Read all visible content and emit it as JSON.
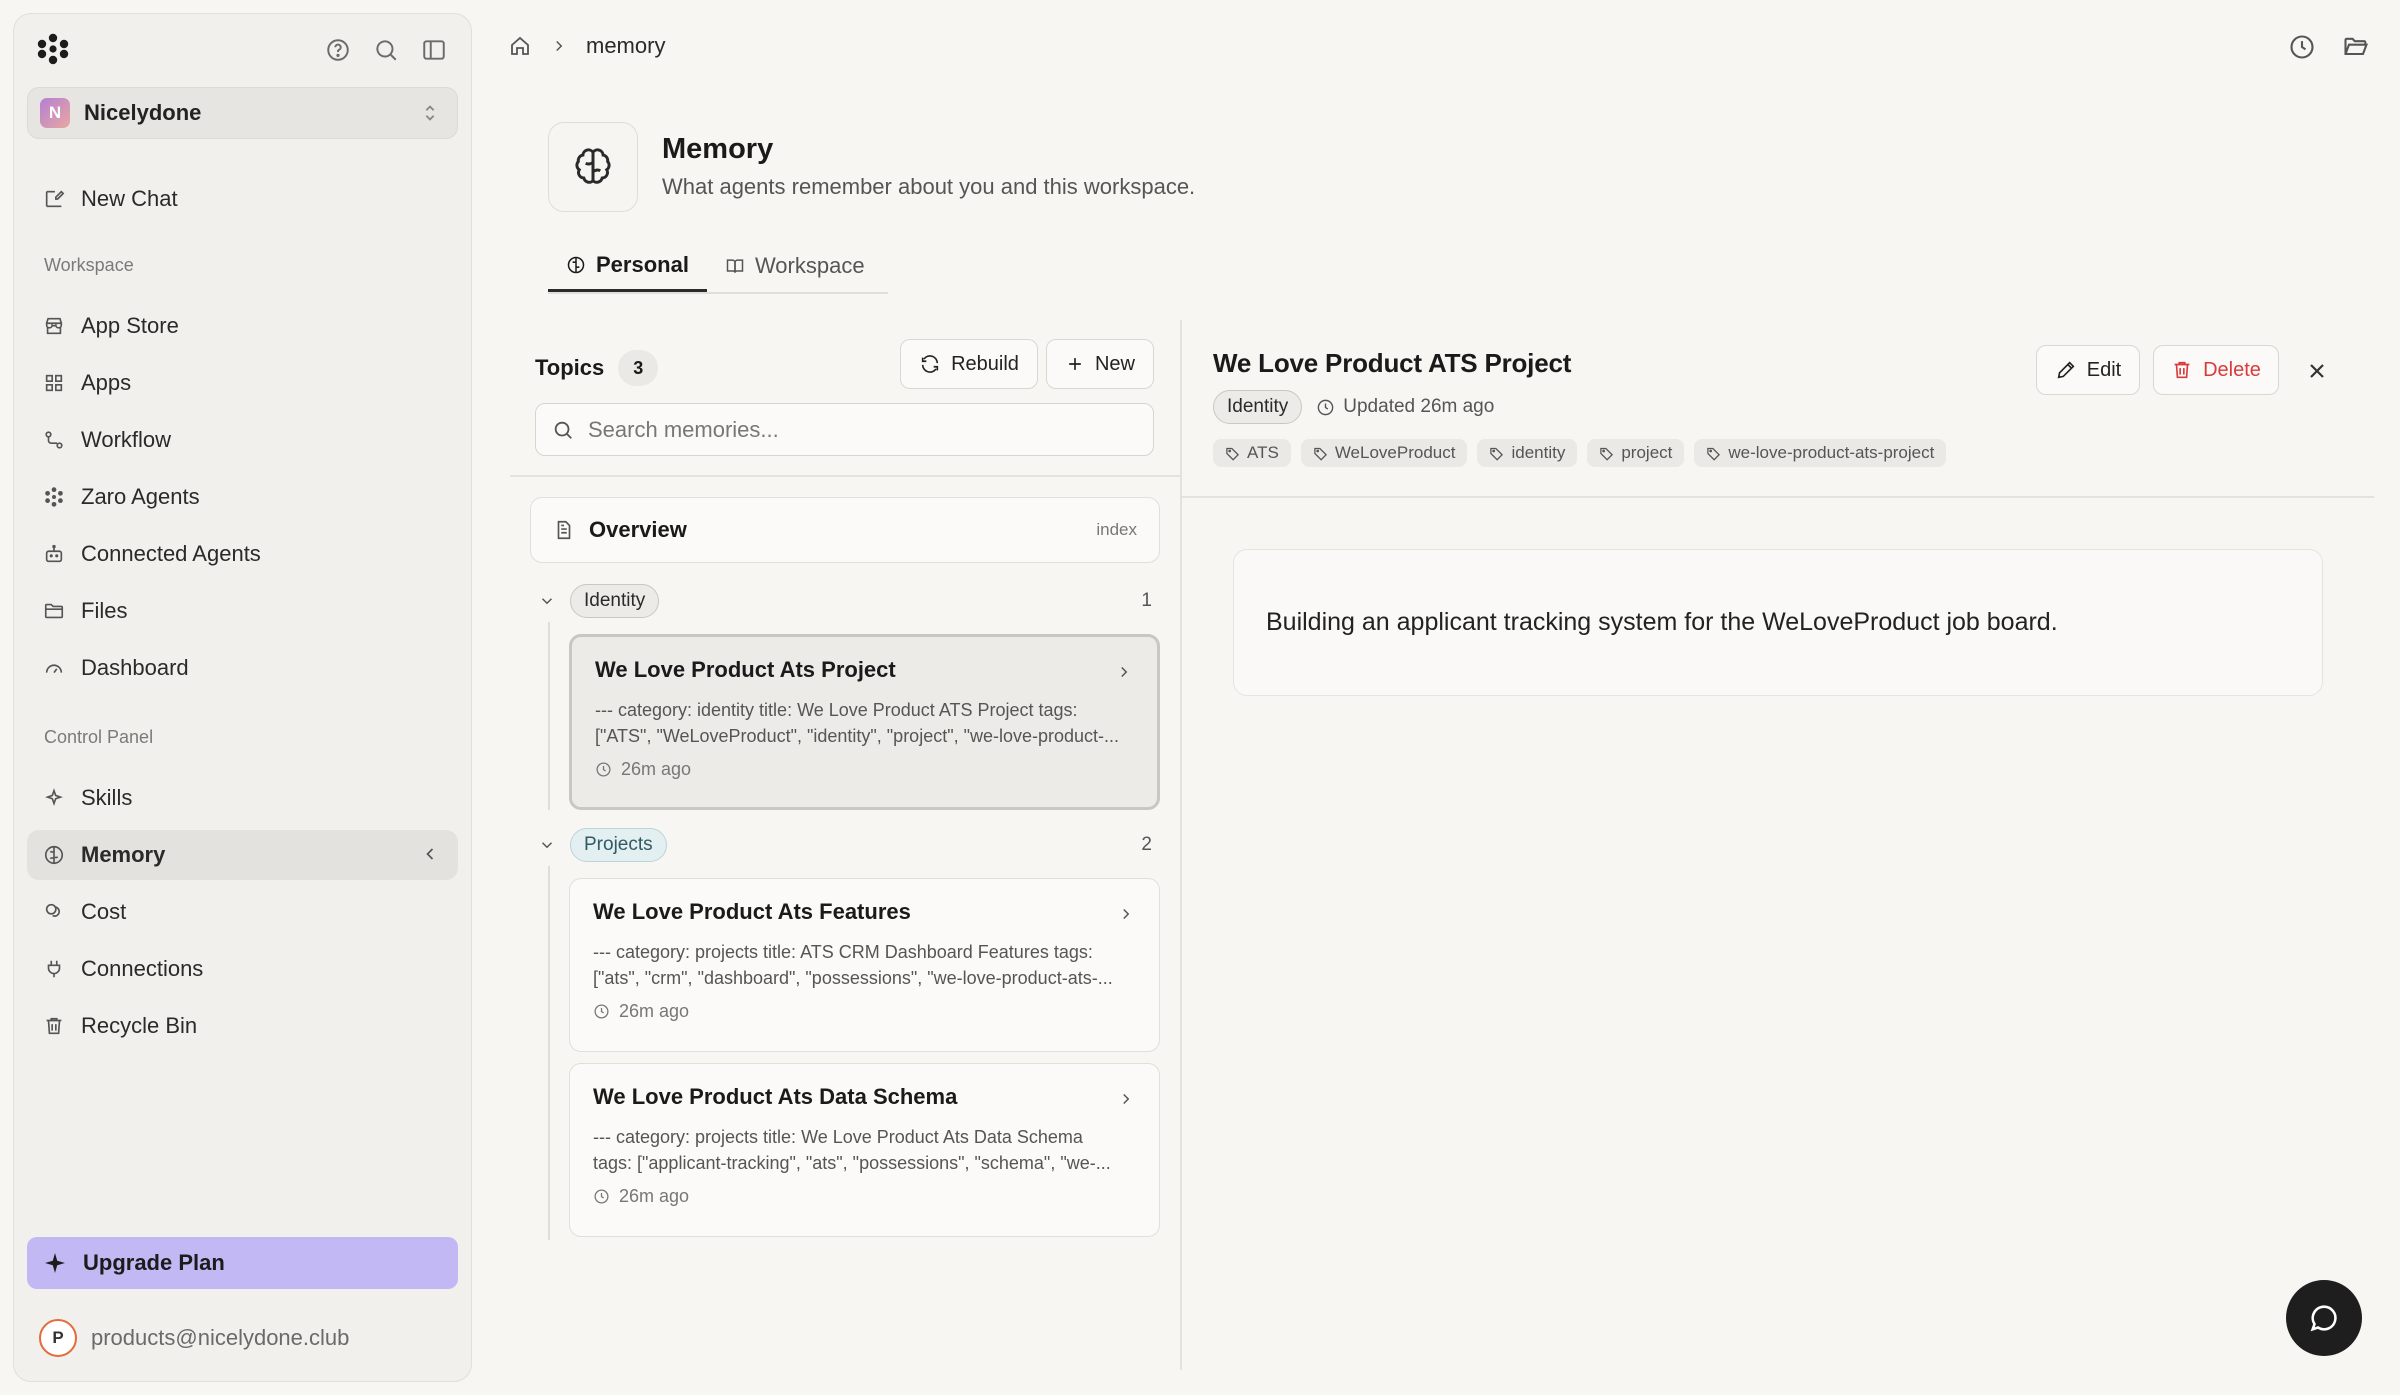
{
  "sidebar": {
    "org": {
      "initial": "N",
      "name": "Nicelydone"
    },
    "new_chat": "New Chat",
    "workspace_label": "Workspace",
    "workspace_items": [
      {
        "label": "App Store",
        "icon": "store-icon"
      },
      {
        "label": "Apps",
        "icon": "apps-grid-icon"
      },
      {
        "label": "Workflow",
        "icon": "workflow-icon"
      },
      {
        "label": "Zaro Agents",
        "icon": "agents-icon"
      },
      {
        "label": "Connected Agents",
        "icon": "bot-icon"
      },
      {
        "label": "Files",
        "icon": "folder-icon"
      },
      {
        "label": "Dashboard",
        "icon": "gauge-icon"
      }
    ],
    "control_label": "Control Panel",
    "control_items": [
      {
        "label": "Skills",
        "icon": "sparkle-icon"
      },
      {
        "label": "Memory",
        "icon": "brain-icon",
        "active": true
      },
      {
        "label": "Cost",
        "icon": "coins-icon"
      },
      {
        "label": "Connections",
        "icon": "plug-icon"
      },
      {
        "label": "Recycle Bin",
        "icon": "trash-icon"
      }
    ],
    "upgrade": "Upgrade Plan",
    "user": {
      "initial": "P",
      "email": "products@nicelydone.club"
    }
  },
  "header": {
    "breadcrumb": "memory"
  },
  "page": {
    "title": "Memory",
    "subtitle": "What agents remember about you and this workspace.",
    "tabs": [
      {
        "label": "Personal",
        "active": true
      },
      {
        "label": "Workspace",
        "active": false
      }
    ]
  },
  "topics": {
    "title": "Topics",
    "count": "3",
    "rebuild": "Rebuild",
    "new": "New",
    "search_placeholder": "Search memories...",
    "overview": {
      "label": "Overview",
      "tag": "index"
    },
    "groups": [
      {
        "name": "Identity",
        "count": "1",
        "items": [
          {
            "title": "We Love Product Ats Project",
            "body_line1": "--- category: identity title: We Love Product ATS Project tags:",
            "body_line2": "[\"ATS\", \"WeLoveProduct\", \"identity\", \"project\", \"we-love-product-...",
            "time": "26m ago"
          }
        ]
      },
      {
        "name": "Projects",
        "count": "2",
        "items": [
          {
            "title": "We Love Product Ats Features",
            "body_line1": "--- category: projects title: ATS CRM Dashboard Features tags:",
            "body_line2": "[\"ats\", \"crm\", \"dashboard\", \"possessions\", \"we-love-product-ats-...",
            "time": "26m ago"
          },
          {
            "title": "We Love Product Ats Data Schema",
            "body_line1": "--- category: projects title: We Love Product Ats Data Schema",
            "body_line2": "tags: [\"applicant-tracking\", \"ats\", \"possessions\", \"schema\", \"we-...",
            "time": "26m ago"
          }
        ]
      }
    ]
  },
  "detail": {
    "title": "We Love Product ATS Project",
    "category": "Identity",
    "updated": "Updated 26m ago",
    "tags": [
      "ATS",
      "WeLoveProduct",
      "identity",
      "project",
      "we-love-product-ats-project"
    ],
    "edit": "Edit",
    "delete": "Delete",
    "content": "Building an applicant tracking system for the WeLoveProduct job board."
  },
  "colors": {
    "accent_upgrade": "#c2b8f4",
    "danger": "#d93b3b",
    "projects_pill": "#e3eff1"
  }
}
